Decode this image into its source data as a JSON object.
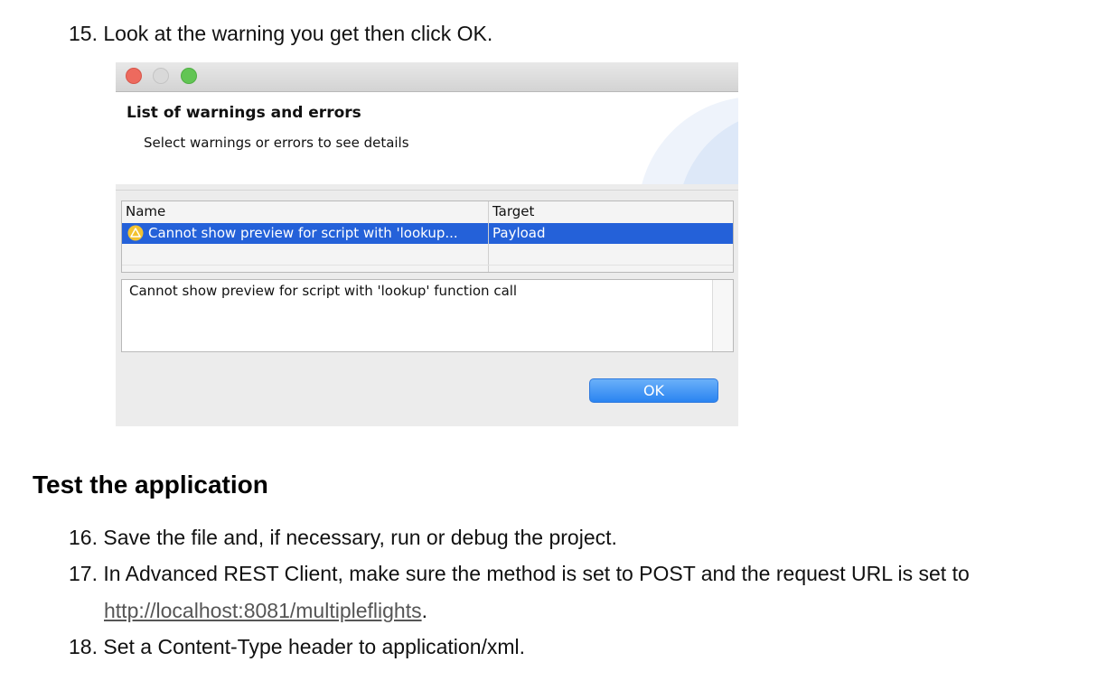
{
  "steps": {
    "s15": {
      "num": "15.",
      "text": "Look at the warning you get then click OK."
    },
    "s16": {
      "num": "16.",
      "text": "Save the file and, if necessary, run or debug the project."
    },
    "s17": {
      "num": "17.",
      "text": "In Advanced REST Client, make sure the method is set to POST and the request URL is set to",
      "link": "http://localhost:8081/multipleflights",
      "after": "."
    },
    "s18": {
      "num": "18.",
      "text": "Set a Content-Type header to application/xml."
    }
  },
  "section_heading": "Test the application",
  "dialog": {
    "title": "List of warnings and errors",
    "subtitle": "Select warnings or errors to see details",
    "columns": {
      "name": "Name",
      "target": "Target"
    },
    "rows": [
      {
        "name": "Cannot show preview for script with 'lookup...",
        "target": "Payload",
        "icon": "warning-icon"
      }
    ],
    "detail": "Cannot show preview for script with 'lookup' function call",
    "ok_label": "OK",
    "colors": {
      "selection": "#2461d9",
      "ok_button": "#2a84f1",
      "close": "#ed6a5e",
      "maximize": "#62c554"
    }
  }
}
